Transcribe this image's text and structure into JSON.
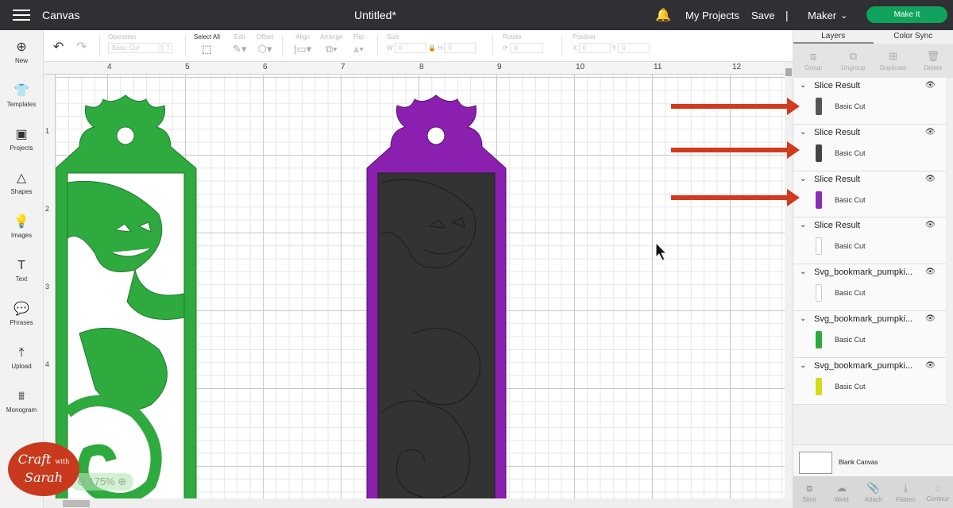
{
  "header": {
    "app": "Canvas",
    "doc_title": "Untitled*",
    "my_projects": "My Projects",
    "save": "Save",
    "sep": "|",
    "machine": "Maker",
    "make_it": "Make It"
  },
  "nav": [
    {
      "label": "New",
      "icon": "⊕"
    },
    {
      "label": "Templates",
      "icon": "👕"
    },
    {
      "label": "Projects",
      "icon": "▣"
    },
    {
      "label": "Shapes",
      "icon": "△"
    },
    {
      "label": "Images",
      "icon": "💡"
    },
    {
      "label": "Text",
      "icon": "T"
    },
    {
      "label": "Phrases",
      "icon": "💬"
    },
    {
      "label": "Upload",
      "icon": "⤒"
    },
    {
      "label": "Monogram",
      "icon": "⩩"
    }
  ],
  "toolbar": {
    "operation_label": "Operation",
    "operation_value": "Basic Cut",
    "help": "?",
    "select_all": "Select All",
    "edit": "Edit",
    "offset": "Offset",
    "align": "Align",
    "arrange": "Arrange",
    "flip": "Flip",
    "size": "Size",
    "w": "W",
    "h": "H",
    "rotate": "Rotate",
    "position": "Position",
    "x": "X",
    "y": "Y",
    "w_val": "0",
    "h_val": "0",
    "rotate_val": "0",
    "x_val": "0",
    "y_val": "0"
  },
  "ruler": {
    "h": [
      "4",
      "5",
      "6",
      "7",
      "8",
      "9",
      "10",
      "11",
      "12"
    ],
    "v": [
      "1",
      "2",
      "3",
      "4"
    ]
  },
  "zoom": "175%",
  "logo": {
    "line1": "Craft",
    "line2": "with",
    "line3": "Sarah"
  },
  "panel": {
    "tabs": [
      "Layers",
      "Color Sync"
    ],
    "actions": [
      "Group",
      "Ungroup",
      "Duplicate",
      "Delete"
    ],
    "layers": [
      {
        "name": "Slice Result",
        "sub": "Basic Cut",
        "color": "#555555"
      },
      {
        "name": "Slice Result",
        "sub": "Basic Cut",
        "color": "#444444"
      },
      {
        "name": "Slice Result",
        "sub": "Basic Cut",
        "color": "#8b2fb0"
      },
      {
        "name": "Slice Result",
        "sub": "Basic Cut",
        "color": "#ffffff"
      },
      {
        "name": "Svg_bookmark_pumpki...",
        "sub": "Basic Cut",
        "color": "#ffffff"
      },
      {
        "name": "Svg_bookmark_pumpki...",
        "sub": "Basic Cut",
        "color": "#2eaa3f"
      },
      {
        "name": "Svg_bookmark_pumpki...",
        "sub": "Basic Cut",
        "color": "#d4dc1a"
      }
    ],
    "blank_canvas": "Blank Canvas",
    "bottom_actions": [
      "Slice",
      "Weld",
      "Attach",
      "Flatten",
      "Contour"
    ]
  },
  "colors": {
    "green": "#2eaa3f",
    "purple": "#8b1fb0",
    "dark": "#333333",
    "make_it": "#10a35b"
  }
}
